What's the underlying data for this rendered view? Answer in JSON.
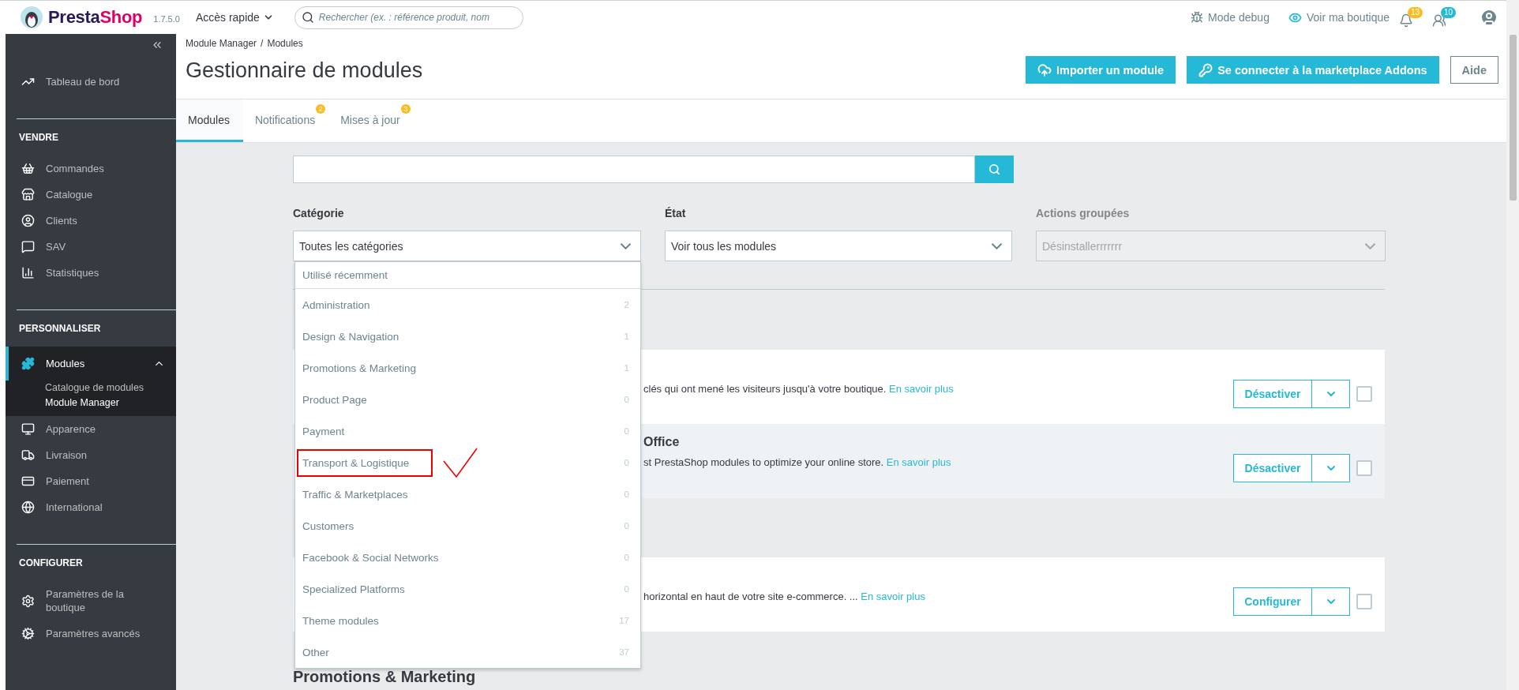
{
  "topbar": {
    "brand": {
      "part_1": "Presta",
      "part_2": "Shop"
    },
    "version": "1.7.5.0",
    "quick_access": "Accès rapide",
    "search": {
      "placeholder": "Rechercher (ex. : référence produit, nom"
    },
    "debug": "Mode debug",
    "view_shop": "Voir ma boutique",
    "notifications": [
      {
        "count": "13",
        "color": "#fbbb22"
      },
      {
        "count": "10",
        "color": "#25b9d7"
      }
    ]
  },
  "sidebar": {
    "groups": [
      {
        "items": [
          {
            "label": "Tableau de bord",
            "selected": false
          }
        ]
      },
      {
        "heading": "VENDRE",
        "items": [
          {
            "label": "Commandes",
            "selected": false
          },
          {
            "label": "Catalogue",
            "selected": false
          },
          {
            "label": "Clients",
            "selected": false
          },
          {
            "label": "SAV",
            "selected": false
          },
          {
            "label": "Statistiques",
            "selected": false
          }
        ]
      },
      {
        "heading": "PERSONNALISER",
        "items": [
          {
            "label": "Modules",
            "selected": true,
            "expanded": true,
            "children": [
              {
                "label": "Catalogue de modules",
                "selected": false
              },
              {
                "label": "Module Manager",
                "selected": true
              }
            ]
          },
          {
            "label": "Apparence",
            "selected": false
          },
          {
            "label": "Livraison",
            "selected": false
          },
          {
            "label": "Paiement",
            "selected": false
          },
          {
            "label": "International",
            "selected": false
          }
        ]
      },
      {
        "heading": "CONFIGURER",
        "items": [
          {
            "label": "Paramètres de la boutique",
            "selected": false
          },
          {
            "label": "Paramètres avancés",
            "selected": false
          }
        ]
      }
    ]
  },
  "header": {
    "breadcrumb": [
      "Module Manager",
      "Modules"
    ],
    "breadcrumb_separator": "/",
    "title": "Gestionnaire de modules",
    "buttons": [
      {
        "kind": "upload",
        "label": "Importer un module"
      },
      {
        "kind": "key",
        "label": "Se connecter à la marketplace Addons"
      },
      {
        "kind": "plain",
        "label": "Aide"
      }
    ]
  },
  "tabs": [
    {
      "label": "Modules",
      "selected": true
    },
    {
      "label": "Notifications",
      "selected": false,
      "badge": "2"
    },
    {
      "label": "Mises à jour",
      "selected": false,
      "badge": "3"
    }
  ],
  "filters": {
    "category": {
      "label": "Catégorie",
      "value": "Toutes les catégories",
      "expanded": true,
      "options_header": "Utilisé récemment",
      "options": [
        {
          "label": "Administration",
          "count": "2",
          "annotated": false
        },
        {
          "label": "Design & Navigation",
          "count": "1",
          "annotated": false
        },
        {
          "label": "Promotions & Marketing",
          "count": "1",
          "annotated": false
        },
        {
          "label": "Product Page",
          "count": "0",
          "annotated": false
        },
        {
          "label": "Payment",
          "count": "0",
          "annotated": false
        },
        {
          "label": "Transport & Logistique",
          "count": "0",
          "annotated": true
        },
        {
          "label": "Traffic & Marketplaces",
          "count": "0",
          "annotated": false
        },
        {
          "label": "Customers",
          "count": "0",
          "annotated": false
        },
        {
          "label": "Facebook & Social Networks",
          "count": "0",
          "annotated": false
        },
        {
          "label": "Specialized Platforms",
          "count": "0",
          "annotated": false
        },
        {
          "label": "Theme modules",
          "count": "17",
          "annotated": false
        },
        {
          "label": "Other",
          "count": "37",
          "annotated": false
        }
      ]
    },
    "state": {
      "label": "État",
      "value": "Voir tous les modules",
      "disabled": false
    },
    "bulk": {
      "label": "Actions groupées",
      "value": "Désinstallerrrrrrr",
      "disabled": true
    }
  },
  "modules": [
    {
      "description": "clés qui ont mené les visiteurs jusqu'à votre boutique.",
      "link": "En savoir plus",
      "action": "Désactiver",
      "checked": false,
      "highlighted": false
    },
    {
      "title": "Office",
      "description": "st PrestaShop modules to optimize your online store.",
      "link": "En savoir plus",
      "action": "Désactiver",
      "checked": false,
      "highlighted": true
    },
    {
      "description": "horizontal en haut de votre site e-commerce. ...",
      "link": "En savoir plus",
      "action": "Configurer",
      "checked": false,
      "highlighted": false
    }
  ],
  "next_section": "Promotions & Marketing"
}
